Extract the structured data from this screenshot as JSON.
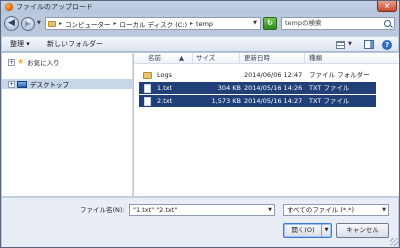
{
  "window": {
    "title": "ファイルのアップロード",
    "close_label": "×"
  },
  "address_bar": {
    "segments": [
      "コンピューター",
      "ローカル ディスク (C:)",
      "temp"
    ],
    "separator": "▸",
    "search_placeholder": "tempの検索"
  },
  "command_bar": {
    "organize_label": "整理 ▾",
    "new_folder_label": "新しいフォルダー"
  },
  "nav_pane": {
    "items": [
      {
        "label": "お気に入り",
        "expander": "+",
        "icon": "star-icon"
      },
      {
        "label": "デスクトップ",
        "expander": "+",
        "icon": "desktop-icon",
        "selected": true
      }
    ]
  },
  "file_list": {
    "columns": [
      "名前",
      "サイズ",
      "更新日時",
      "種類"
    ],
    "rows": [
      {
        "name": "Logs",
        "size": "",
        "modified": "2014/06/06 12:47",
        "type": "ファイル フォルダー",
        "icon": "folder-icon",
        "selected": false
      },
      {
        "name": "1.txt",
        "size": "304 KB",
        "modified": "2014/05/16 14:26",
        "type": "TXT ファイル",
        "icon": "file-icon",
        "selected": true
      },
      {
        "name": "2.txt",
        "size": "1,573 KB",
        "modified": "2014/05/16 14:27",
        "type": "TXT ファイル",
        "icon": "file-icon",
        "selected": true
      }
    ]
  },
  "bottom": {
    "filename_label": "ファイル名(N):",
    "filename_value": "\"1.txt\" \"2.txt\"",
    "filetype_value": "すべてのファイル (*.*)",
    "open_label": "開く(O)",
    "cancel_label": "キャンセル"
  },
  "colors": {
    "selection": "#21407a",
    "chrome": "#bcc9dc",
    "accent": "#3d7bd6"
  }
}
